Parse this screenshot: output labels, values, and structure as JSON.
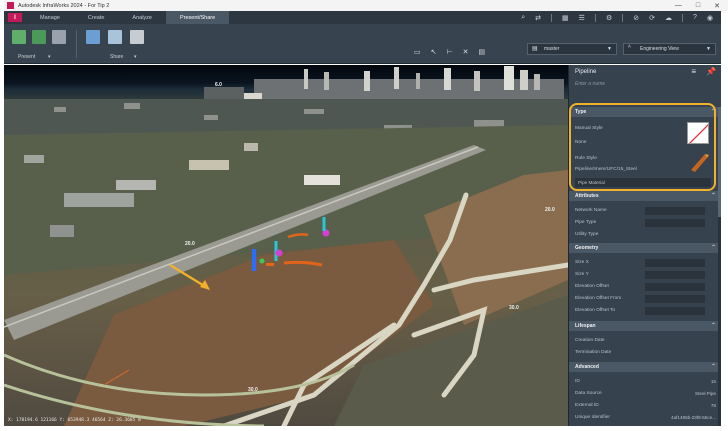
{
  "window": {
    "title": "Autodesk InfraWorks 2024 - For Tip 2",
    "controls": [
      "—",
      "□",
      "✕"
    ]
  },
  "ribbon": {
    "app_badge": "I",
    "tabs": [
      {
        "label": "Manage",
        "active": false
      },
      {
        "label": "Create",
        "active": false
      },
      {
        "label": "Analyze",
        "active": false
      },
      {
        "label": "Present/Share",
        "active": true
      }
    ],
    "groups": {
      "present_label": "Present",
      "share_label": "Share"
    },
    "proposal_dropdown": "master",
    "view_dropdown": "Engineering View"
  },
  "viewport": {
    "coord_readout": "X: 178194.6 121166 Y: 653948.3 46564 Z: 26.3685 m",
    "labels": {
      "top_center": "6.0",
      "right_road": "20.0",
      "left_road": "20.0",
      "bottom_center": "30.0",
      "right_bottom": "30.0"
    }
  },
  "panel": {
    "title": "Pipeline",
    "subtitle": "Enter a name",
    "sections": {
      "type": {
        "label": "Type",
        "rows": [
          {
            "label": "Manual Style"
          },
          {
            "label": "None"
          },
          {
            "label": "Rule Style"
          }
        ],
        "rule_style_value": "Pipeline/Imem/UFC/15_Steel",
        "pipe_material": "Pipe Material"
      },
      "attributes": {
        "label": "Attributes",
        "rows": [
          {
            "label": "Network Name"
          },
          {
            "label": "Pipe Type"
          },
          {
            "label": "Utility Type"
          }
        ]
      },
      "geometry": {
        "label": "Geometry",
        "rows": [
          {
            "label": "Size X"
          },
          {
            "label": "Size Y"
          },
          {
            "label": "Elevation Offset"
          },
          {
            "label": "Elevation Offset From"
          },
          {
            "label": "Elevation Offset To"
          }
        ]
      },
      "lifespan": {
        "label": "Lifespan",
        "rows": [
          {
            "label": "Creation Date"
          },
          {
            "label": "Termination Date"
          }
        ]
      },
      "advanced": {
        "label": "Advanced",
        "rows": [
          {
            "label": "ID",
            "value": "15"
          },
          {
            "label": "Data Source",
            "value": "Steel Pipe"
          },
          {
            "label": "External ID",
            "value": "78"
          },
          {
            "label": "Unique Identifier",
            "value": "4af1485b-23f8-55ce..."
          }
        ]
      }
    }
  },
  "colors": {
    "accent_highlight": "#f1b12a",
    "ribbon_bg": "#37434f",
    "tab_bar_bg": "#2c3742",
    "app_brand": "#c41a5a",
    "panel_bg": "#36424e"
  }
}
